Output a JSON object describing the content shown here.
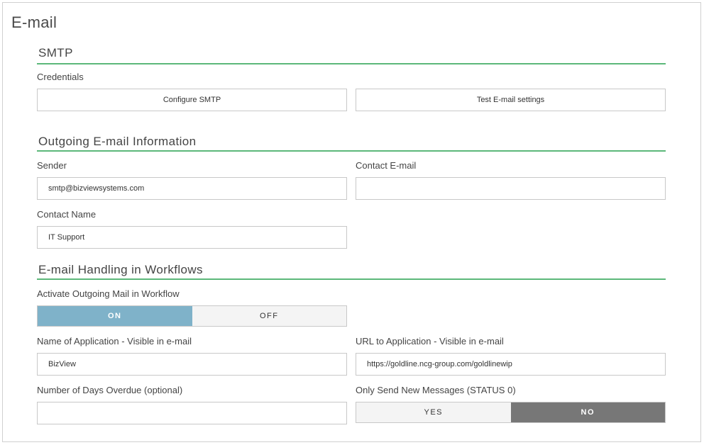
{
  "page": {
    "title": "E-mail"
  },
  "smtp": {
    "title": "SMTP",
    "credentials_label": "Credentials",
    "configure_button": "Configure SMTP",
    "test_button": "Test E-mail settings"
  },
  "outgoing": {
    "title": "Outgoing E-mail Information",
    "sender_label": "Sender",
    "sender_value": "smtp@bizviewsystems.com",
    "contact_email_label": "Contact E-mail",
    "contact_email_value": "",
    "contact_name_label": "Contact Name",
    "contact_name_value": "IT Support"
  },
  "workflows": {
    "title": "E-mail Handling in Workflows",
    "activate_label": "Activate Outgoing Mail in Workflow",
    "activate_on": "ON",
    "activate_off": "OFF",
    "activate_selected": "ON",
    "app_name_label": "Name of Application - Visible in e-mail",
    "app_name_value": "BizView",
    "app_url_label": "URL to Application - Visible in e-mail",
    "app_url_value": "https://goldline.ncg-group.com/goldlinewip",
    "days_overdue_label": "Number of Days Overdue (optional)",
    "days_overdue_value": "",
    "only_new_label": "Only Send New Messages (STATUS 0)",
    "only_new_yes": "YES",
    "only_new_no": "NO",
    "only_new_selected": "NO"
  },
  "colors": {
    "accent_line": "#5cb87a",
    "toggle_on": "#7fb2c9",
    "toggle_no": "#777777"
  }
}
